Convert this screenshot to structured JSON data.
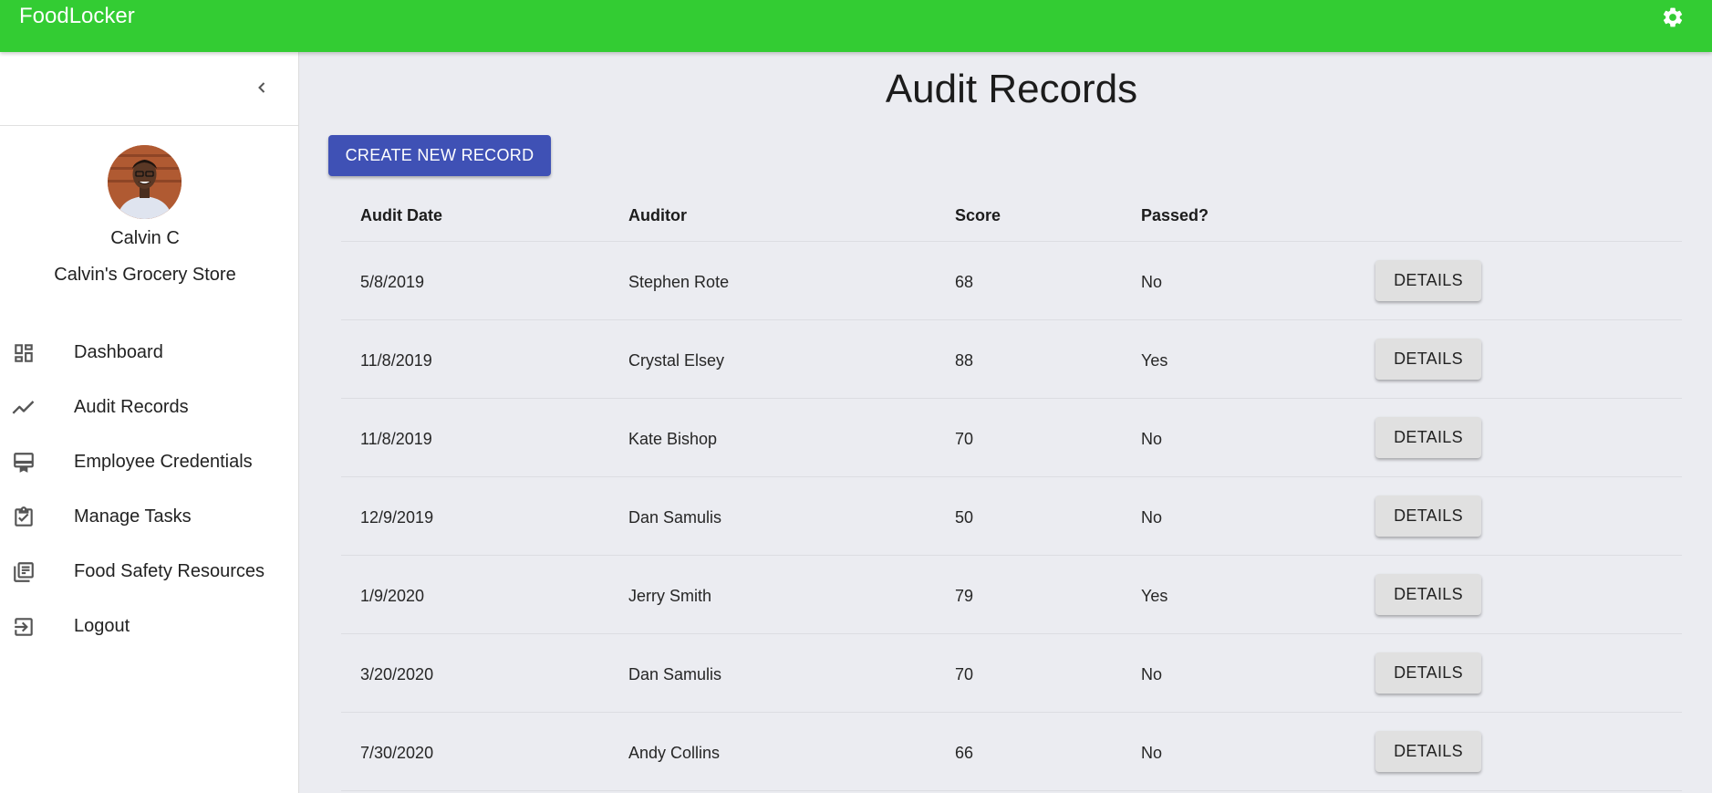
{
  "app": {
    "title": "FoodLocker"
  },
  "colors": {
    "appbar": "#33cc33",
    "primary_button": "#3f51b5",
    "secondary_button": "#e0e0e0",
    "background": "#ebecf1"
  },
  "user": {
    "name": "Calvin C",
    "store": "Calvin's Grocery Store"
  },
  "nav": {
    "dashboard": {
      "label": "Dashboard",
      "icon": "dashboard-icon"
    },
    "audit_records": {
      "label": "Audit Records",
      "icon": "trending-line-icon"
    },
    "employee_credentials": {
      "label": "Employee Credentials",
      "icon": "credential-card-icon"
    },
    "manage_tasks": {
      "label": "Manage Tasks",
      "icon": "clipboard-check-icon"
    },
    "food_safety": {
      "label": "Food Safety Resources",
      "icon": "library-books-icon"
    },
    "logout": {
      "label": "Logout",
      "icon": "logout-icon"
    }
  },
  "page": {
    "title": "Audit Records",
    "create_label": "CREATE NEW RECORD"
  },
  "table": {
    "headers": {
      "date": "Audit Date",
      "auditor": "Auditor",
      "score": "Score",
      "passed": "Passed?"
    },
    "details_label": "DETAILS",
    "rows": [
      {
        "date": "5/8/2019",
        "auditor": "Stephen Rote",
        "score": "68",
        "passed": "No"
      },
      {
        "date": "11/8/2019",
        "auditor": "Crystal Elsey",
        "score": "88",
        "passed": "Yes"
      },
      {
        "date": "11/8/2019",
        "auditor": "Kate Bishop",
        "score": "70",
        "passed": "No"
      },
      {
        "date": "12/9/2019",
        "auditor": "Dan Samulis",
        "score": "50",
        "passed": "No"
      },
      {
        "date": "1/9/2020",
        "auditor": "Jerry Smith",
        "score": "79",
        "passed": "Yes"
      },
      {
        "date": "3/20/2020",
        "auditor": "Dan Samulis",
        "score": "70",
        "passed": "No"
      },
      {
        "date": "7/30/2020",
        "auditor": "Andy Collins",
        "score": "66",
        "passed": "No"
      }
    ]
  }
}
